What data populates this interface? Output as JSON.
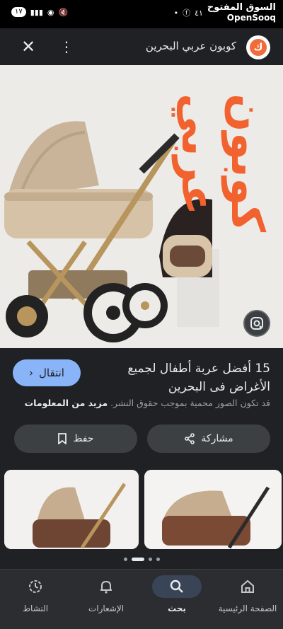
{
  "status_bar": {
    "notif_count": "١٧",
    "battery": "٤١",
    "watermark_ar": "السوق المفتوح",
    "watermark_en": "OpenSooq"
  },
  "header": {
    "site_name": "كوبون عربي البحرين",
    "logo_letter": "ك"
  },
  "hero": {
    "brand_text": "كوبون عربي"
  },
  "result": {
    "visit_label": "انتقال",
    "title": "15 أفضل عربة أطفال لجميع الأغراض فى البحرين",
    "copyright_text": "قد تكون الصور محمية بموجب حقوق النشر.",
    "more_info": "مزيد من المعلومات"
  },
  "actions": {
    "share_label": "مشاركة",
    "save_label": "حفظ"
  },
  "bottom_nav": [
    {
      "label": "الصفحة الرئيسية",
      "icon": "home-icon"
    },
    {
      "label": "بحث",
      "icon": "search-icon"
    },
    {
      "label": "الإشعارات",
      "icon": "bell-icon"
    },
    {
      "label": "النشاط",
      "icon": "history-icon"
    }
  ],
  "colors": {
    "accent": "#8ab4f8",
    "brand_orange": "#f2622e",
    "background": "#202124"
  }
}
